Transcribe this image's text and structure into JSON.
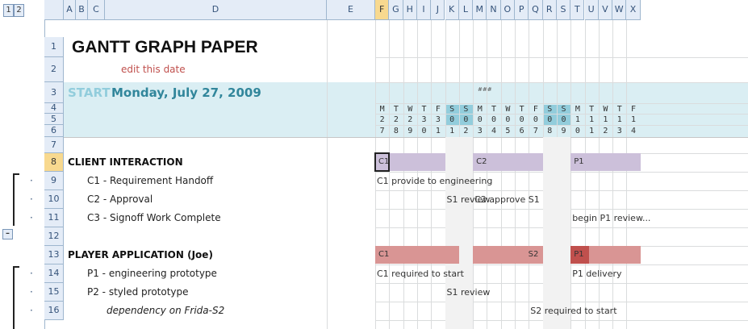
{
  "outline_levels": [
    "1",
    "2"
  ],
  "columns": [
    "A",
    "B",
    "C",
    "D",
    "E",
    "F",
    "G",
    "H",
    "I",
    "J",
    "K",
    "L",
    "M",
    "N",
    "O",
    "P",
    "Q",
    "R",
    "S",
    "T",
    "U",
    "V",
    "W",
    "X"
  ],
  "selected_column": "F",
  "rows": [
    {
      "n": "1",
      "label": "GANTT GRAPH PAPER"
    },
    {
      "n": "2",
      "label": "edit this date"
    },
    {
      "n": "3",
      "label_start": "START",
      "label_date": "Monday, July 27, 2009"
    },
    {
      "n": "4"
    },
    {
      "n": "5"
    },
    {
      "n": "6"
    },
    {
      "n": "7"
    },
    {
      "n": "8",
      "label": "CLIENT INTERACTION"
    },
    {
      "n": "9",
      "label": "C1 - Requirement Handoff"
    },
    {
      "n": "10",
      "label": "C2 - Approval"
    },
    {
      "n": "11",
      "label": "C3 - Signoff Work Complete"
    },
    {
      "n": "12"
    },
    {
      "n": "13",
      "label": "PLAYER APPLICATION (Joe)"
    },
    {
      "n": "14",
      "label": "P1 - engineering prototype"
    },
    {
      "n": "15",
      "label": "P2 - styled prototype"
    },
    {
      "n": "16",
      "label": "dependency on Frida-S2"
    }
  ],
  "selected_row": "8",
  "weekdays": [
    "M",
    "T",
    "W",
    "T",
    "F",
    "S",
    "S",
    "M",
    "T",
    "W",
    "T",
    "F",
    "S",
    "S",
    "M",
    "T",
    "W",
    "T",
    "F"
  ],
  "day_tens": [
    "2",
    "2",
    "2",
    "3",
    "3",
    "0",
    "0",
    "0",
    "0",
    "0",
    "0",
    "0",
    "0",
    "0",
    "1",
    "1",
    "1",
    "1",
    "1"
  ],
  "day_ones": [
    "7",
    "8",
    "9",
    "0",
    "1",
    "1",
    "2",
    "3",
    "4",
    "5",
    "6",
    "7",
    "8",
    "9",
    "0",
    "1",
    "2",
    "3",
    "4"
  ],
  "tiny_note": "###",
  "bars_client": [
    {
      "label": "C1",
      "start": 0,
      "span": 5
    },
    {
      "label": "C2",
      "start": 7,
      "span": 5
    },
    {
      "label": "P1",
      "start": 14,
      "span": 5
    }
  ],
  "bars_player": [
    {
      "label": "C1",
      "start": 0,
      "span": 6,
      "color": "#d99594"
    },
    {
      "label": "S2",
      "start": 7,
      "span": 5,
      "color": "#d99594"
    },
    {
      "label": "P1",
      "start": 14,
      "span": 5,
      "color": "#d99594",
      "head_color": "#c0504d"
    }
  ],
  "annotations": [
    {
      "row": 9,
      "col": 0,
      "text": "C1 provide to engineering"
    },
    {
      "row": 10,
      "col": 5,
      "text": "S1 review"
    },
    {
      "row": 10,
      "col": 7,
      "text": "C2 approve S1"
    },
    {
      "row": 11,
      "col": 14,
      "text": "begin P1 review..."
    },
    {
      "row": 14,
      "col": 0,
      "text": "C1 required to start"
    },
    {
      "row": 14,
      "col": 14,
      "text": "P1 delivery"
    },
    {
      "row": 15,
      "col": 5,
      "text": "S1 review"
    },
    {
      "row": 16,
      "col": 11,
      "text": "S2 required to start"
    }
  ],
  "colors": {
    "header_bg": "#e4ecf7",
    "selected_header": "#f8d98f",
    "title_band": "#daeef3",
    "weekend": "#92cddc",
    "client_bar": "#ccc0da",
    "player_bar": "#d99594",
    "player_head": "#c0504d",
    "start_text": "#92cddc",
    "date_text": "#31869b"
  }
}
